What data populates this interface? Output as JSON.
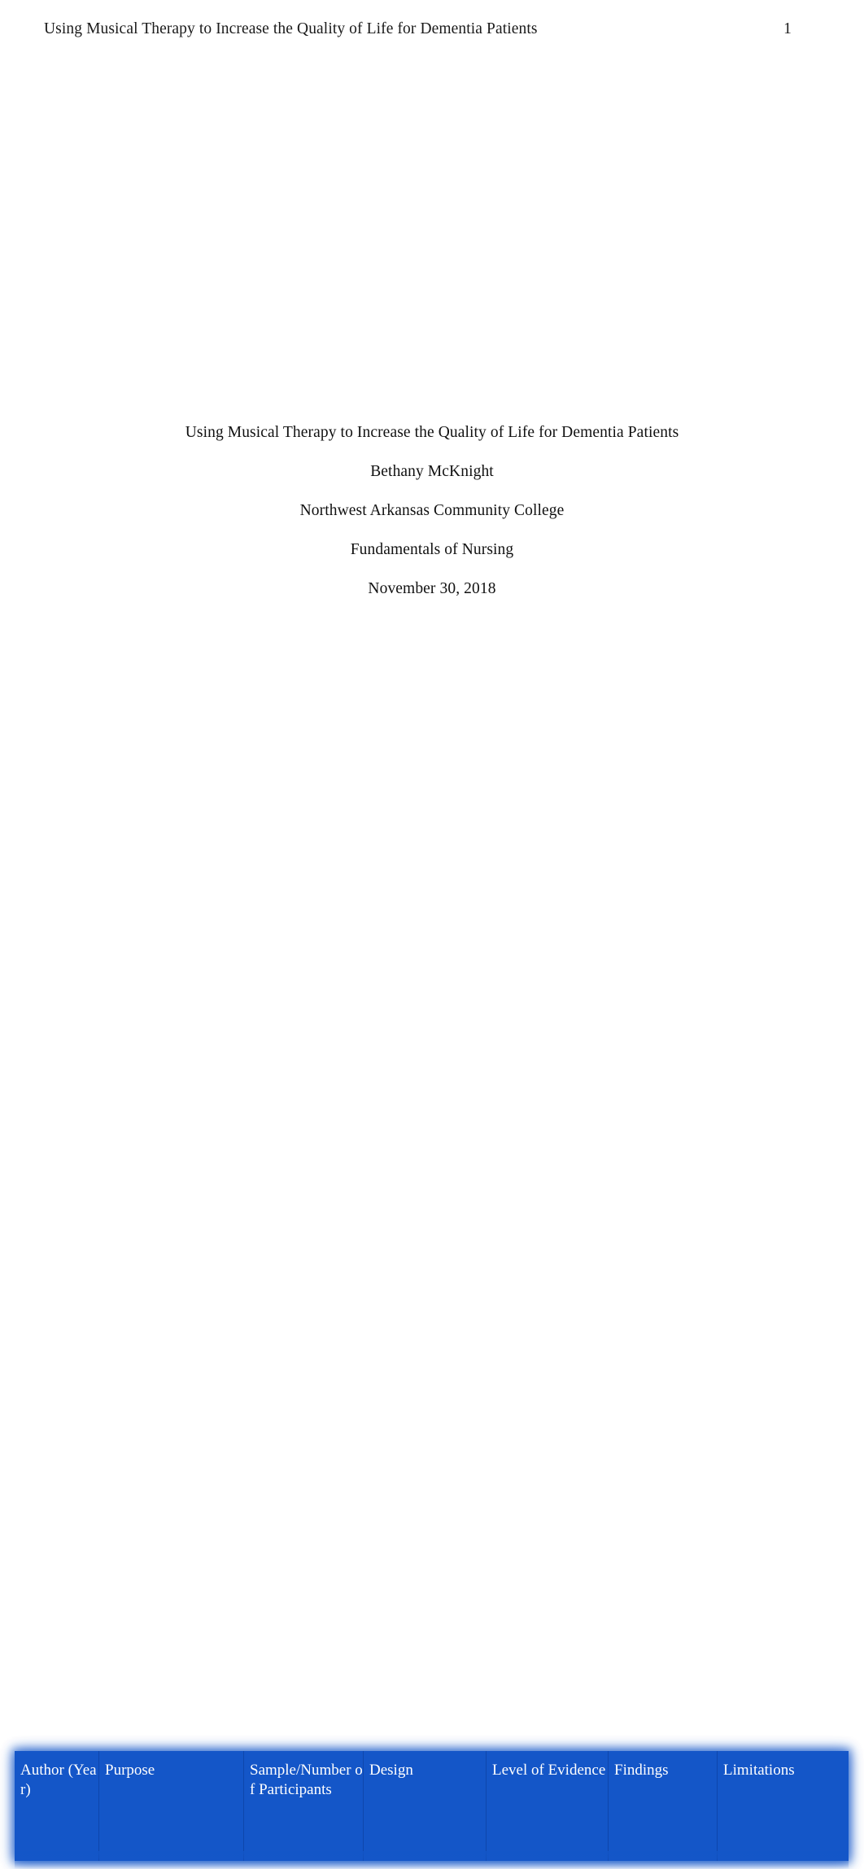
{
  "page": {
    "running_head": "Using Musical Therapy to Increase the Quality of Life for Dementia Patients",
    "page_number": "1"
  },
  "title_block": {
    "title": "Using Musical Therapy to Increase the Quality of Life for Dementia Patients",
    "author": "Bethany McKnight",
    "institution": "Northwest Arkansas Community College",
    "course": "Fundamentals of Nursing",
    "date": "November 30, 2018"
  },
  "evidence_table": {
    "header_background": "#1456c8",
    "header_text_color": "#ffffff",
    "columns": [
      {
        "label": "Author (Year)"
      },
      {
        "label": "Purpose"
      },
      {
        "label": "Sample/Number of Participants"
      },
      {
        "label": "Design"
      },
      {
        "label": "Level of Evidence"
      },
      {
        "label": "Findings"
      },
      {
        "label": "Limitations"
      }
    ]
  }
}
